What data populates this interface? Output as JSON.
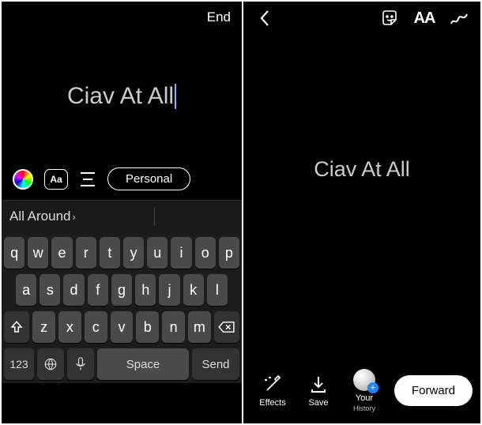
{
  "left": {
    "top_right": "End",
    "text": "Ciav At All",
    "tools": {
      "font_label": "Aa",
      "mention_label": "Personal"
    },
    "suggestion": "All Around",
    "keyboard": {
      "row1": [
        "q",
        "w",
        "e",
        "r",
        "t",
        "y",
        "u",
        "i",
        "o",
        "p"
      ],
      "row2": [
        "a",
        "s",
        "d",
        "f",
        "g",
        "h",
        "j",
        "k",
        "l"
      ],
      "row3": [
        "z",
        "x",
        "c",
        "v",
        "b",
        "n",
        "m"
      ],
      "num_key": "123",
      "space_key": "Space",
      "send_key": "Send"
    }
  },
  "right": {
    "aa_label": "AA",
    "text": "Ciav At All",
    "bottom": {
      "effects": "Effects",
      "save": "Save",
      "story": "Your",
      "story_sub": "History",
      "forward": "Forward"
    }
  }
}
